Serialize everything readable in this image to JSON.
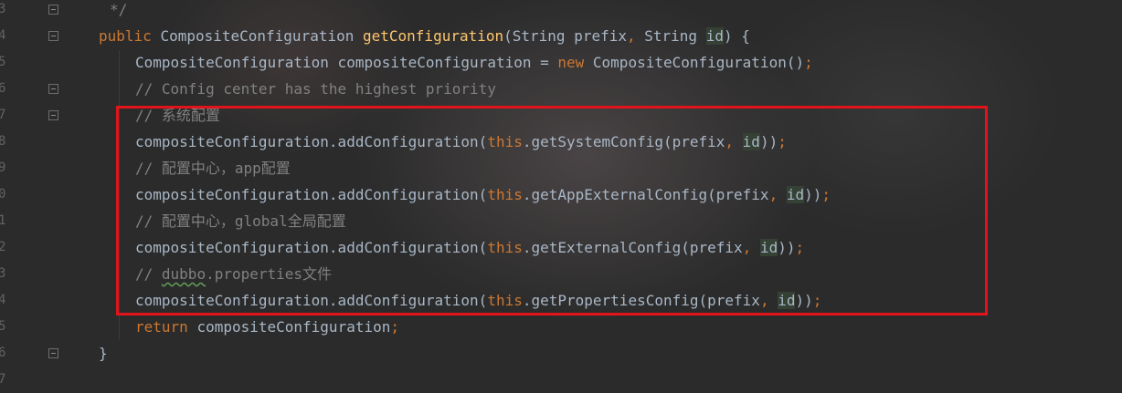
{
  "editor": {
    "line_numbers": [
      "3",
      "4",
      "5",
      "6",
      "7",
      "8",
      "9",
      "0",
      "1",
      "2",
      "3",
      "4",
      "5",
      "6",
      "7"
    ],
    "lines": [
      {
        "id": "l0",
        "tokens": [
          {
            "t": "*/",
            "c": "cm"
          }
        ]
      },
      {
        "id": "l1",
        "tokens": [
          {
            "t": "public ",
            "c": "kw"
          },
          {
            "t": "CompositeConfiguration ",
            "c": ""
          },
          {
            "t": "getConfiguration",
            "c": "fn"
          },
          {
            "t": "(String prefix",
            "c": ""
          },
          {
            "t": ", ",
            "c": "kw"
          },
          {
            "t": "String ",
            "c": ""
          },
          {
            "t": "id",
            "c": "param"
          },
          {
            "t": ") {",
            "c": ""
          }
        ]
      },
      {
        "id": "l2",
        "tokens": [
          {
            "t": "CompositeConfiguration compositeConfiguration = ",
            "c": ""
          },
          {
            "t": "new ",
            "c": "kw"
          },
          {
            "t": "CompositeConfiguration()",
            "c": ""
          },
          {
            "t": ";",
            "c": "kw"
          }
        ]
      },
      {
        "id": "l3",
        "tokens": [
          {
            "t": "// Config center has the highest priority",
            "c": "cm"
          }
        ]
      },
      {
        "id": "l4",
        "tokens": [
          {
            "t": "// 系统配置",
            "c": "cm"
          }
        ]
      },
      {
        "id": "l5",
        "tokens": [
          {
            "t": "compositeConfiguration.addConfiguration(",
            "c": ""
          },
          {
            "t": "this",
            "c": "kw"
          },
          {
            "t": ".getSystemConfig(prefix",
            "c": ""
          },
          {
            "t": ", ",
            "c": "kw"
          },
          {
            "t": "id",
            "c": "param"
          },
          {
            "t": "))",
            "c": ""
          },
          {
            "t": ";",
            "c": "kw"
          }
        ]
      },
      {
        "id": "l6",
        "tokens": [
          {
            "t": "// 配置中心，app配置",
            "c": "cm"
          }
        ]
      },
      {
        "id": "l7",
        "tokens": [
          {
            "t": "compositeConfiguration.addConfiguration(",
            "c": ""
          },
          {
            "t": "this",
            "c": "kw"
          },
          {
            "t": ".getAppExternalConfig(prefix",
            "c": ""
          },
          {
            "t": ", ",
            "c": "kw"
          },
          {
            "t": "id",
            "c": "param"
          },
          {
            "t": "))",
            "c": ""
          },
          {
            "t": ";",
            "c": "kw"
          }
        ]
      },
      {
        "id": "l8",
        "tokens": [
          {
            "t": "// 配置中心，global全局配置",
            "c": "cm"
          }
        ]
      },
      {
        "id": "l9",
        "tokens": [
          {
            "t": "compositeConfiguration.addConfiguration(",
            "c": ""
          },
          {
            "t": "this",
            "c": "kw"
          },
          {
            "t": ".getExternalConfig(prefix",
            "c": ""
          },
          {
            "t": ", ",
            "c": "kw"
          },
          {
            "t": "id",
            "c": "param"
          },
          {
            "t": "))",
            "c": ""
          },
          {
            "t": ";",
            "c": "kw"
          }
        ]
      },
      {
        "id": "l10",
        "tokens": [
          {
            "t": "// ",
            "c": "cm"
          },
          {
            "t": "dubbo",
            "c": "cm squiggle"
          },
          {
            "t": ".properties文件",
            "c": "cm"
          }
        ]
      },
      {
        "id": "l11",
        "tokens": [
          {
            "t": "compositeConfiguration.addConfiguration(",
            "c": ""
          },
          {
            "t": "this",
            "c": "kw"
          },
          {
            "t": ".getPropertiesConfig(prefix",
            "c": ""
          },
          {
            "t": ", ",
            "c": "kw"
          },
          {
            "t": "id",
            "c": "param"
          },
          {
            "t": "))",
            "c": ""
          },
          {
            "t": ";",
            "c": "kw"
          }
        ]
      },
      {
        "id": "l12",
        "tokens": [
          {
            "t": "return ",
            "c": "kw"
          },
          {
            "t": "compositeConfiguration",
            "c": ""
          },
          {
            "t": ";",
            "c": "kw"
          }
        ]
      },
      {
        "id": "l13",
        "tokens": [
          {
            "t": "}",
            "c": ""
          }
        ]
      }
    ]
  },
  "colors": {
    "keyword": "#cc7832",
    "method": "#ffc66d",
    "comment": "#808080",
    "text": "#a9b7c6",
    "highlight_border": "#e0141a"
  }
}
